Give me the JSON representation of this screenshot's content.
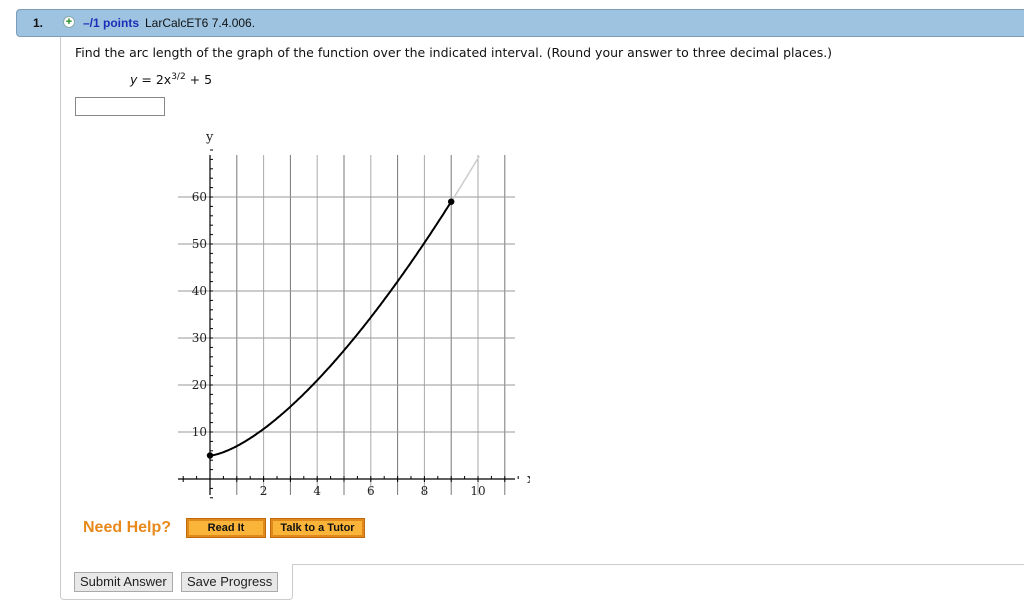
{
  "question": {
    "number": "1.",
    "plus_icon": "plus-circle-icon",
    "points": "–/1 points",
    "reference": "LarCalcET6 7.4.006.",
    "prompt": "Find the arc length of the graph of the function over the indicated interval. (Round your answer to three decimal places.)",
    "formula_lhs": "y",
    "formula_mid": " = 2x",
    "formula_exp": "3/2",
    "formula_rhs": " + 5",
    "answer_value": ""
  },
  "graph": {
    "x_axis_label": "x",
    "y_axis_label": "y",
    "x_ticks": [
      "2",
      "4",
      "6",
      "8",
      "10"
    ],
    "y_ticks": [
      "10",
      "20",
      "30",
      "40",
      "50",
      "60"
    ],
    "interval": [
      0,
      9
    ],
    "endpoints": [
      [
        0,
        5
      ],
      [
        9,
        59
      ]
    ]
  },
  "help": {
    "label": "Need Help?",
    "read_it": "Read It",
    "talk_tutor": "Talk to a Tutor"
  },
  "actions": {
    "submit": "Submit Answer",
    "save": "Save Progress"
  }
}
